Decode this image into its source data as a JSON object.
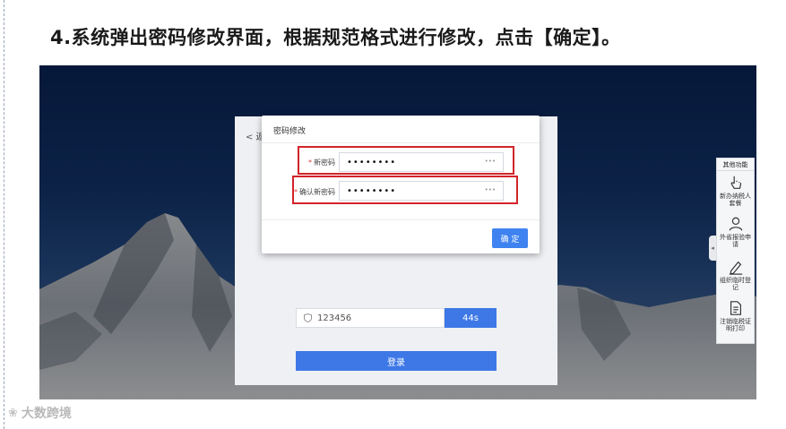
{
  "heading": "4.系统弹出密码修改界面，根据规范格式进行修改，点击【确定】。",
  "login": {
    "back_label": "< 返",
    "code_value": "123456",
    "countdown": "44s",
    "login_label": "登录"
  },
  "modal": {
    "title": "密码修改",
    "fields": [
      {
        "required_mark": "*",
        "label": "新密码",
        "value": "••••••••",
        "eye": "\u0000"
      },
      {
        "required_mark": "*",
        "label": "确认新密码",
        "value": "••••••••",
        "eye": "\u0000"
      }
    ],
    "confirm_label": "确 定"
  },
  "side_panel": {
    "title": "其他功能",
    "items": [
      {
        "icon": "hand-pointer-icon",
        "label": "新办纳税人套餐"
      },
      {
        "icon": "user-icon",
        "label": "外省报验申请"
      },
      {
        "icon": "pen-icon",
        "label": "组织临时登记"
      },
      {
        "icon": "document-icon",
        "label": "注销临税证明打印"
      }
    ]
  },
  "watermark": "大数跨境",
  "colors": {
    "accent": "#3f83f0",
    "highlight": "#d2232a"
  }
}
